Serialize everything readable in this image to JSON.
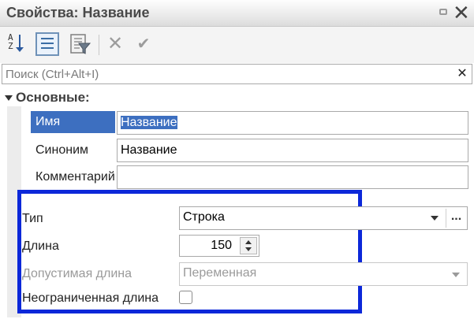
{
  "window": {
    "title": "Свойства: Название"
  },
  "toolbar": {
    "sort_icon_text": "A\nZ",
    "delete_symbol": "✕",
    "ok_symbol": "✔"
  },
  "search": {
    "placeholder": "Поиск (Ctrl+Alt+I)",
    "clear_symbol": "✕"
  },
  "section": {
    "title": "Основные:"
  },
  "properties": {
    "name_label": "Имя",
    "name_value": "Название",
    "synonym_label": "Синоним",
    "synonym_value": "Название",
    "comment_label": "Комментарий",
    "comment_value": ""
  },
  "type_block": {
    "type_label": "Тип",
    "type_value": "Строка",
    "more_symbol": "...",
    "length_label": "Длина",
    "length_value": "150",
    "allowed_length_label": "Допустимая длина",
    "allowed_length_value": "Переменная",
    "unlimited_label": "Неограниченная длина"
  },
  "colors": {
    "highlight_frame": "#0c28d9",
    "selection": "#3d6fc0"
  }
}
